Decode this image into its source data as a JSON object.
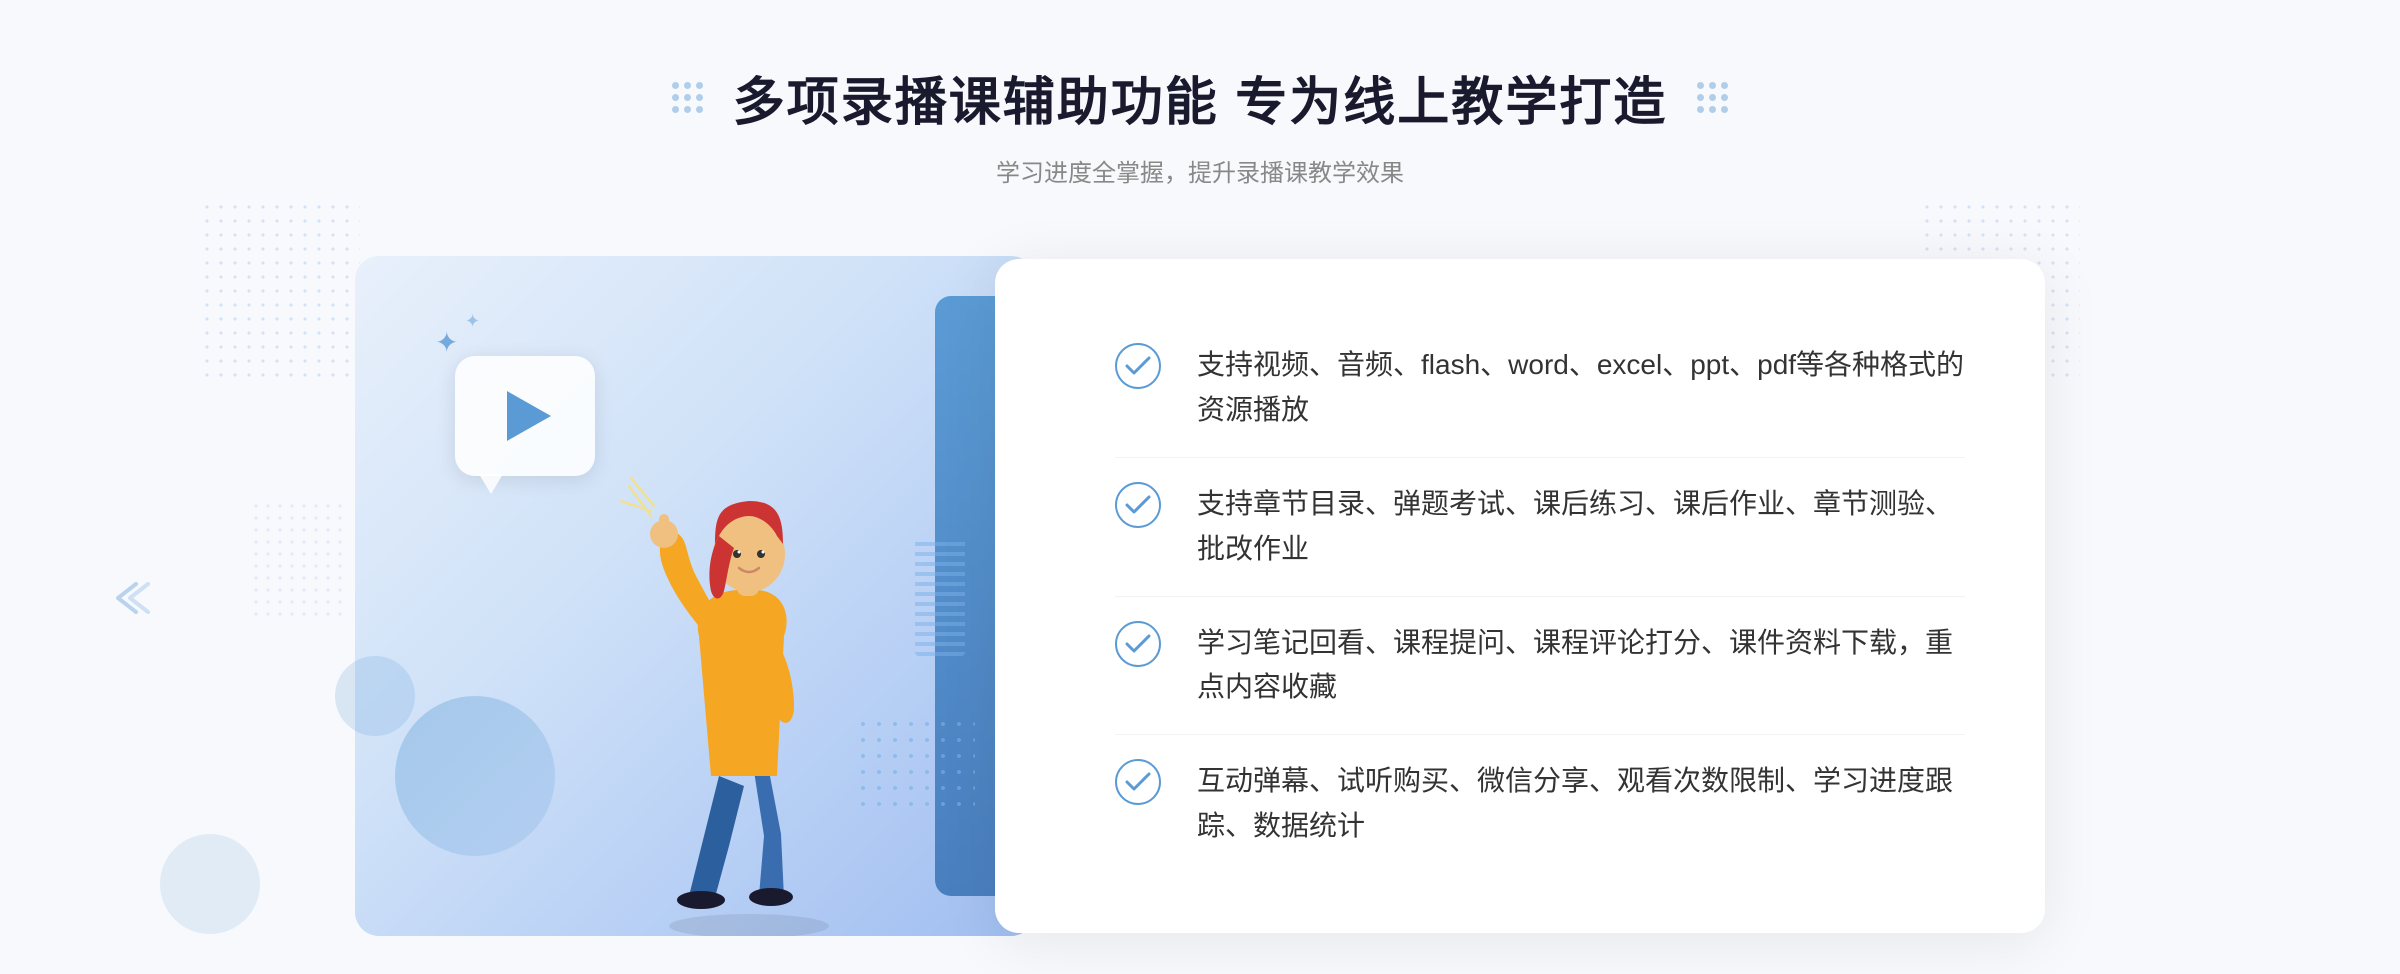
{
  "header": {
    "title": "多项录播课辅助功能 专为线上教学打造",
    "subtitle": "学习进度全掌握，提升录播课教学效果",
    "left_decorator": "grid-dots",
    "right_decorator": "grid-dots"
  },
  "features": [
    {
      "id": 1,
      "text": "支持视频、音频、flash、word、excel、ppt、pdf等各种格式的资源播放"
    },
    {
      "id": 2,
      "text": "支持章节目录、弹题考试、课后练习、课后作业、章节测验、批改作业"
    },
    {
      "id": 3,
      "text": "学习笔记回看、课程提问、课程评论打分、课件资料下载，重点内容收藏"
    },
    {
      "id": 4,
      "text": "互动弹幕、试听购买、微信分享、观看次数限制、学习进度跟踪、数据统计"
    }
  ],
  "colors": {
    "primary_blue": "#5b9bd5",
    "dark_blue": "#4a7fbf",
    "light_bg": "#f8f9fc",
    "text_dark": "#1a1a2e",
    "text_gray": "#888888",
    "text_body": "#333333"
  }
}
